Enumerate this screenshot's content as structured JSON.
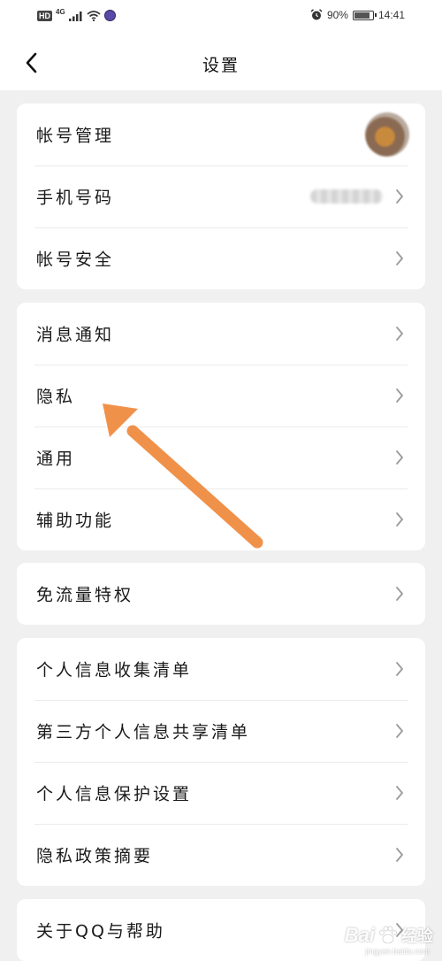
{
  "status_bar": {
    "hd": "HD",
    "network": "4G",
    "battery_text": "90%",
    "battery_level": 0.9,
    "time": "14:41"
  },
  "nav": {
    "title": "设置",
    "back_icon": "chevron-left-icon"
  },
  "groups": [
    {
      "items": [
        {
          "label": "帐号管理",
          "trailing": "avatar"
        },
        {
          "label": "手机号码",
          "trailing": "masked-value"
        },
        {
          "label": "帐号安全"
        }
      ]
    },
    {
      "items": [
        {
          "label": "消息通知"
        },
        {
          "label": "隐私"
        },
        {
          "label": "通用"
        },
        {
          "label": "辅助功能"
        }
      ]
    },
    {
      "items": [
        {
          "label": "免流量特权"
        }
      ]
    },
    {
      "items": [
        {
          "label": "个人信息收集清单"
        },
        {
          "label": "第三方个人信息共享清单"
        },
        {
          "label": "个人信息保护设置"
        },
        {
          "label": "隐私政策摘要"
        }
      ]
    },
    {
      "items": [
        {
          "label": "关于QQ与帮助"
        }
      ]
    }
  ],
  "annotation": {
    "color": "#f0914a",
    "icon": "arrow-annotation-icon"
  },
  "watermark": {
    "main": "Bai",
    "suffix": "经验",
    "url": "jingyan.baidu.com"
  },
  "colors": {
    "background": "#f0f0f0",
    "card": "#ffffff",
    "divider": "#ebebeb",
    "chevron": "#9a9a9a"
  }
}
